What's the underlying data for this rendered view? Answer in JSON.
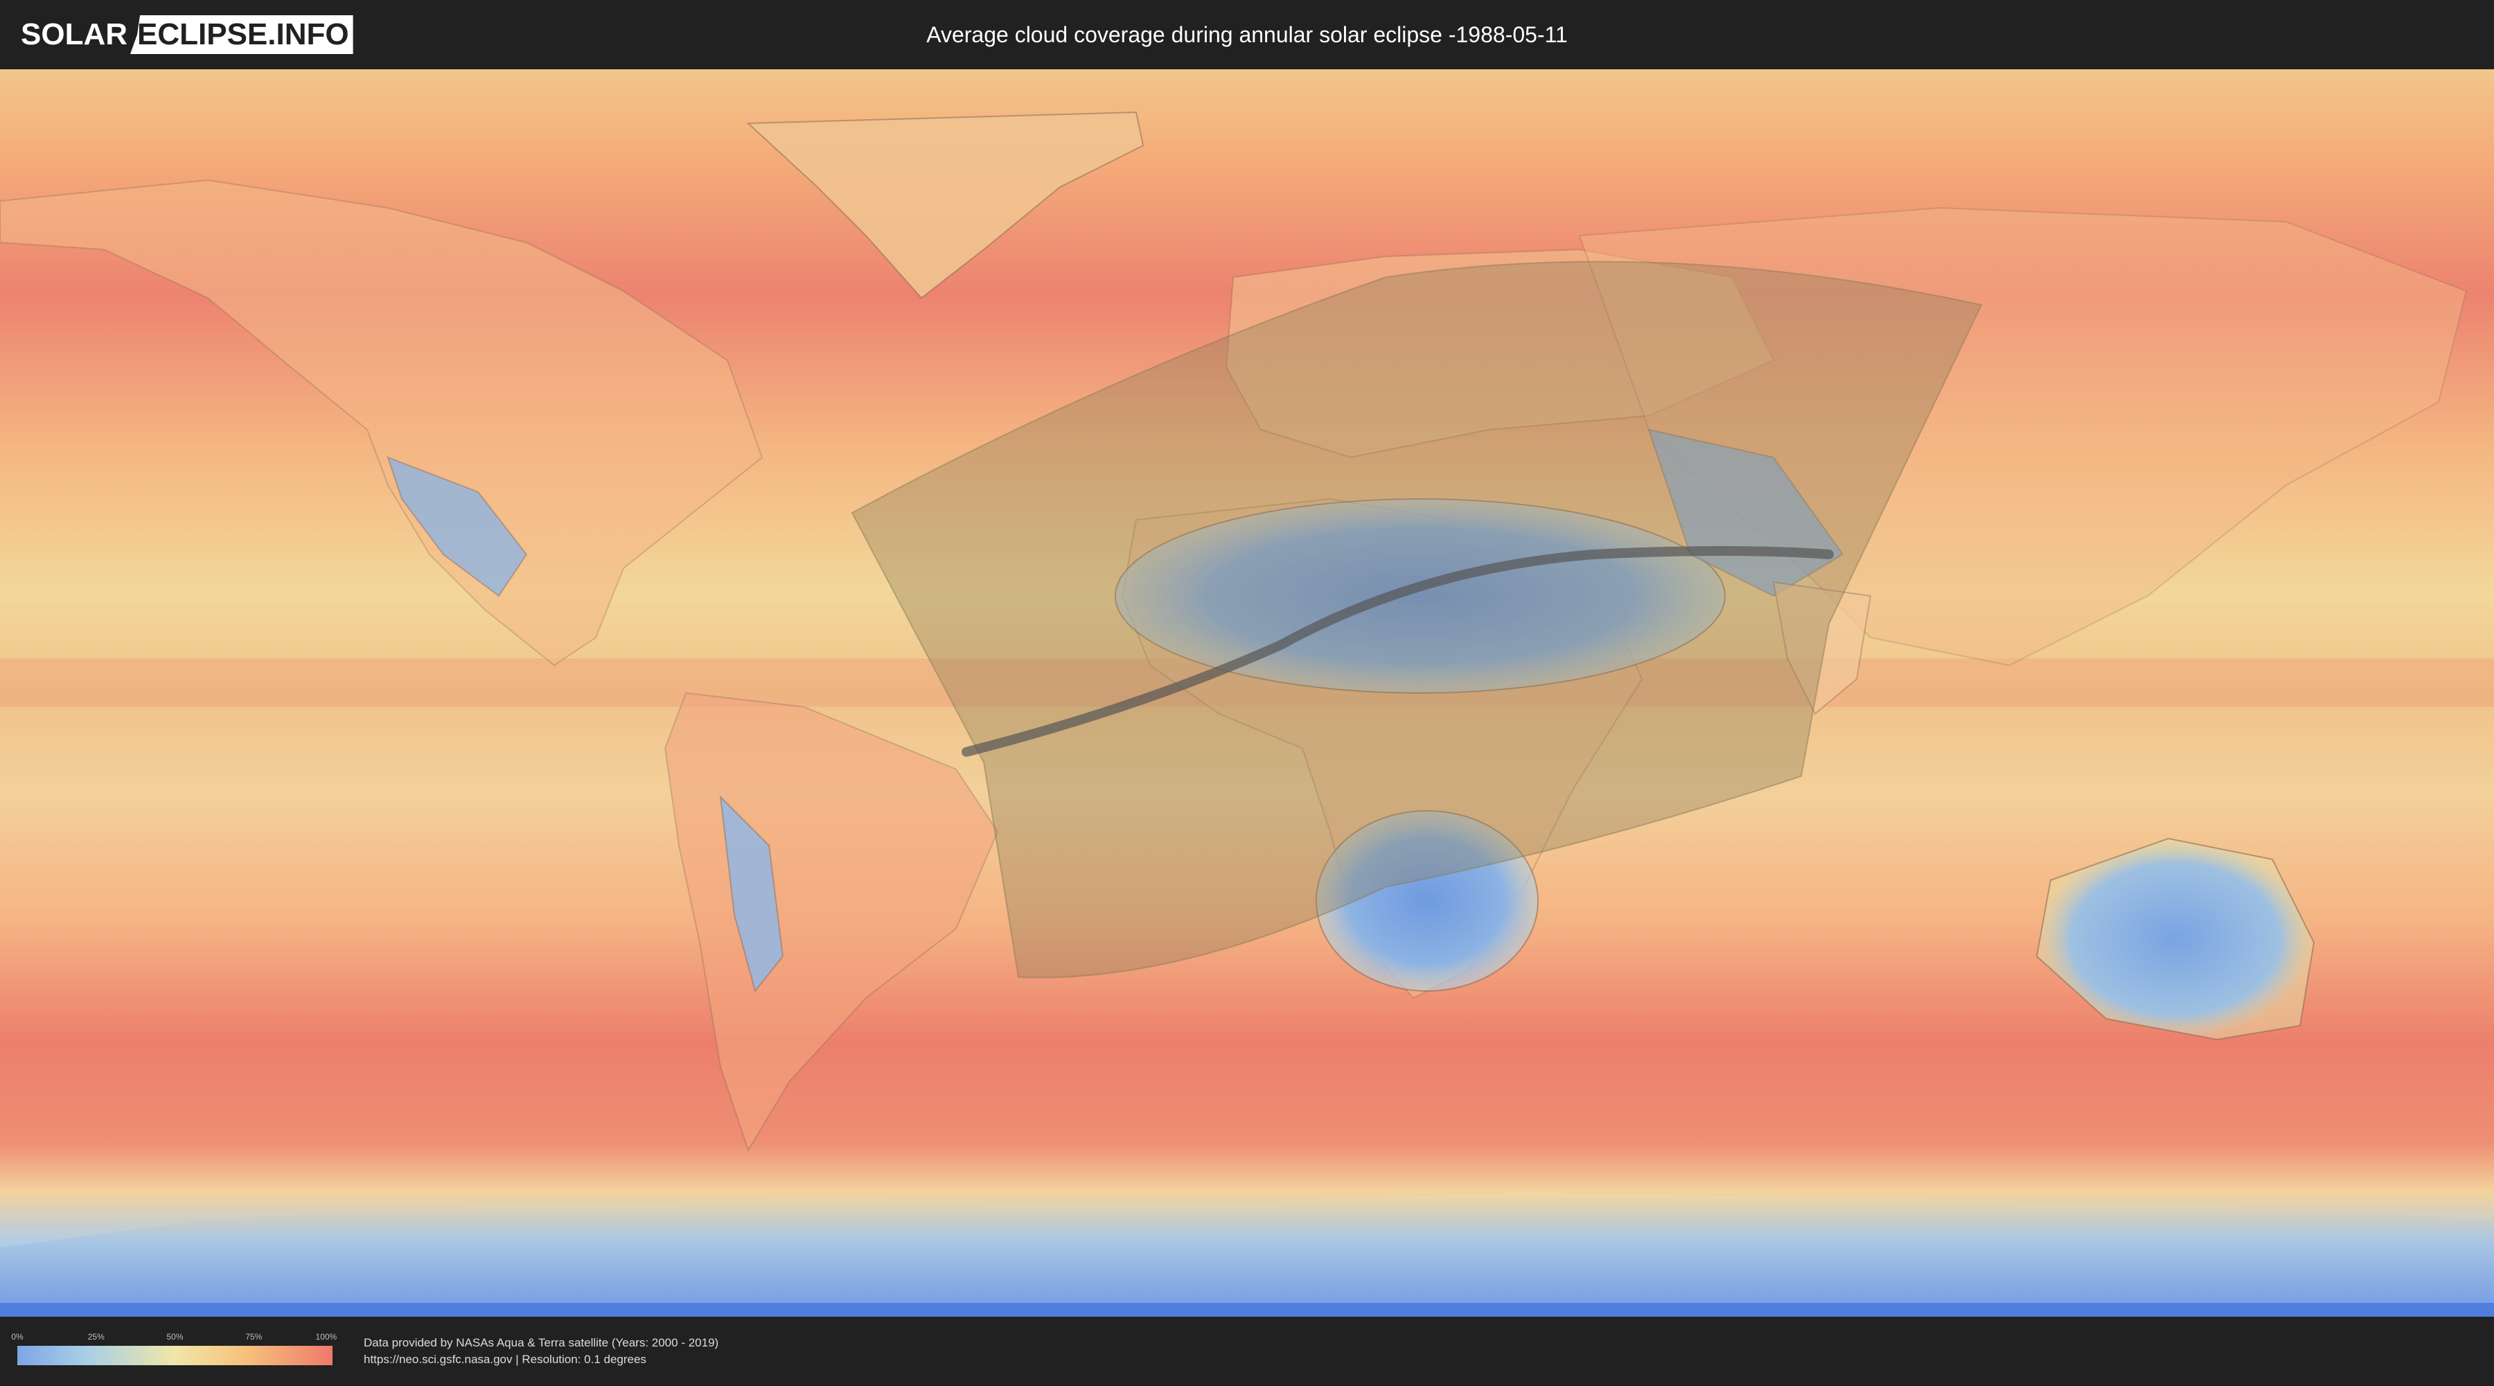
{
  "header": {
    "logo_part1": "SOLAR",
    "logo_part2": "ECLIPSE.INFO",
    "title": "Average cloud coverage during annular solar eclipse -1988-05-11"
  },
  "legend": {
    "ticks": [
      "0%",
      "25%",
      "50%",
      "75%",
      "100%"
    ],
    "colors": [
      "#7ea6e6",
      "#a9cfe6",
      "#f0e6a8",
      "#f6c27c",
      "#ee7a6c"
    ]
  },
  "credits": {
    "line1": "Data provided by NASAs Aqua & Terra satellite (Years: 2000 - 2019)",
    "line2": "https://neo.sci.gsfc.nasa.gov | Resolution: 0.1 degrees"
  },
  "map": {
    "ocean_color": "#f19a7a",
    "clear_color": "#7ea6e6",
    "path_color": "#555555",
    "penumbra_color": "#8a7a5a"
  }
}
